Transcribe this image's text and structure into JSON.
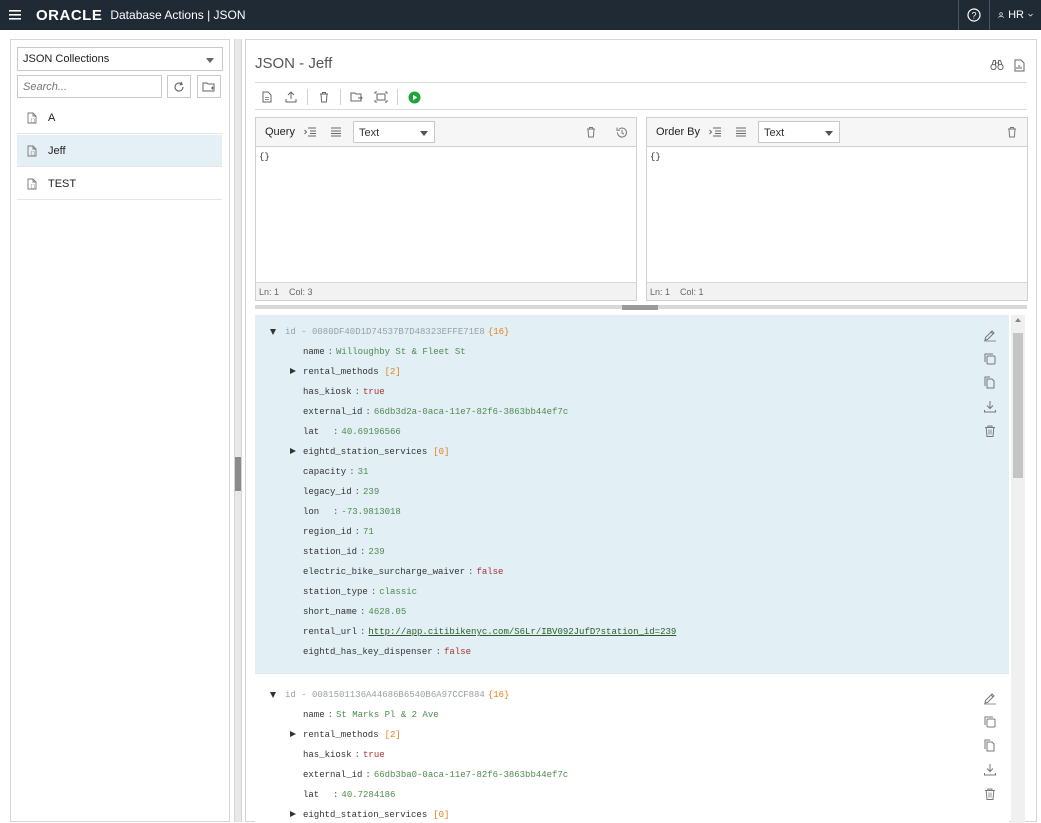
{
  "header": {
    "brand": "ORACLE",
    "app_title": "Database Actions | JSON",
    "user": "HR"
  },
  "sidebar": {
    "collection_type": "JSON Collections",
    "search_placeholder": "Search...",
    "items": [
      {
        "label": "A",
        "active": false
      },
      {
        "label": "Jeff",
        "active": true
      },
      {
        "label": "TEST",
        "active": false
      }
    ]
  },
  "main": {
    "title": "JSON - Jeff",
    "query": {
      "label": "Query",
      "format": "Text",
      "text": "{}",
      "status_ln": "Ln: 1",
      "status_col": "Col: 3"
    },
    "orderby": {
      "label": "Order By",
      "format": "Text",
      "text": "{}",
      "status_ln": "Ln: 1",
      "status_col": "Col: 1"
    }
  },
  "documents": [
    {
      "id_label": "id - 0080DF40D1D74537B7D48323EFFE71E8",
      "count": "{16}",
      "fields": [
        {
          "key": "name",
          "value": "Willoughby St & Fleet St",
          "type": "str"
        },
        {
          "key": "rental_methods",
          "value": "[2]",
          "type": "arr"
        },
        {
          "key": "has_kiosk",
          "value": "true",
          "type": "bool"
        },
        {
          "key": "external_id",
          "value": "66db3d2a-0aca-11e7-82f6-3863bb44ef7c",
          "type": "str"
        },
        {
          "key": "lat  ",
          "value": "40.69196566",
          "type": "num"
        },
        {
          "key": "eightd_station_services",
          "value": "[0]",
          "type": "arr"
        },
        {
          "key": "capacity",
          "value": "31",
          "type": "num"
        },
        {
          "key": "legacy_id",
          "value": "239",
          "type": "str"
        },
        {
          "key": "lon  ",
          "value": "-73.9813018",
          "type": "num"
        },
        {
          "key": "region_id",
          "value": "71",
          "type": "str"
        },
        {
          "key": "station_id",
          "value": "239",
          "type": "str"
        },
        {
          "key": "electric_bike_surcharge_waiver",
          "value": "false",
          "type": "bool"
        },
        {
          "key": "station_type",
          "value": "classic",
          "type": "str"
        },
        {
          "key": "short_name",
          "value": "4628.05",
          "type": "str"
        },
        {
          "key": "rental_url",
          "value": "http://app.citibikenyc.com/S6Lr/IBV092JufD?station_id=239",
          "type": "link"
        },
        {
          "key": "eightd_has_key_dispenser",
          "value": "false",
          "type": "bool"
        }
      ]
    },
    {
      "id_label": "id - 0081501136A44686B6540B6A97CCF884",
      "count": "{16}",
      "fields": [
        {
          "key": "name",
          "value": "St Marks Pl & 2 Ave",
          "type": "str"
        },
        {
          "key": "rental_methods",
          "value": "[2]",
          "type": "arr"
        },
        {
          "key": "has_kiosk",
          "value": "true",
          "type": "bool"
        },
        {
          "key": "external_id",
          "value": "66db3ba0-0aca-11e7-82f6-3863bb44ef7c",
          "type": "str"
        },
        {
          "key": "lat  ",
          "value": "40.7284186",
          "type": "num"
        },
        {
          "key": "eightd_station_services",
          "value": "[0]",
          "type": "arr"
        }
      ]
    }
  ]
}
